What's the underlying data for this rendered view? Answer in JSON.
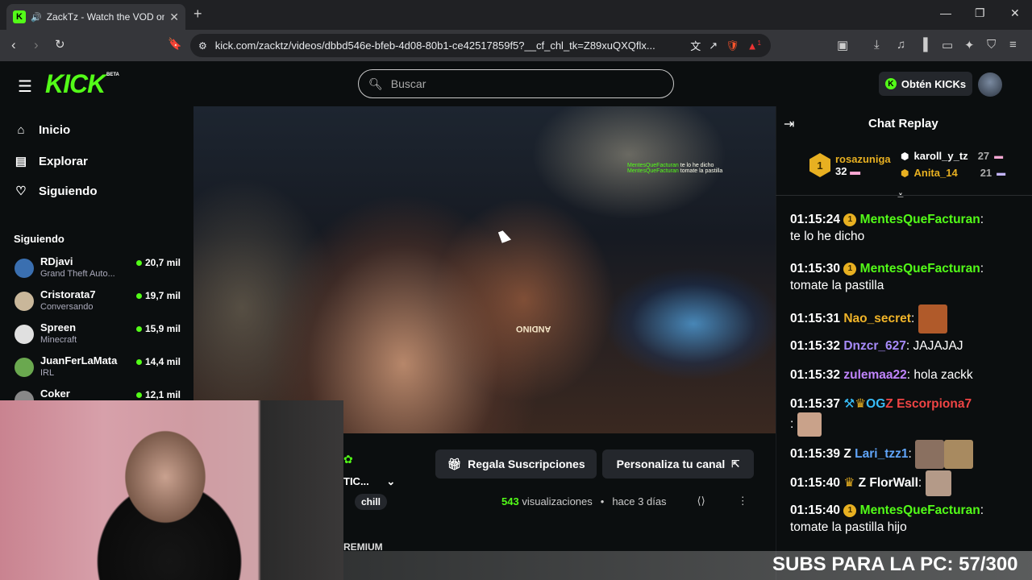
{
  "browser": {
    "tab_title": "ZackTz - Watch the VOD on Kick",
    "url": "kick.com/zacktz/videos/dbbd546e-bfeb-4d08-80b1-ce42517859f5?__cf_chl_tk=Z89xuQXQflx...",
    "ext_badge": "1"
  },
  "header": {
    "logo": "KICK",
    "beta": "BETA",
    "search_placeholder": "Buscar",
    "kicks_label": "Obtén KICKs"
  },
  "sidebar": {
    "nav": [
      {
        "label": "Inicio",
        "icon": "home-icon"
      },
      {
        "label": "Explorar",
        "icon": "compass-icon"
      },
      {
        "label": "Siguiendo",
        "icon": "heart-icon"
      }
    ],
    "section_title": "Siguiendo",
    "following": [
      {
        "name": "RDjavi",
        "category": "Grand Theft Auto...",
        "viewers": "20,7 mil",
        "color": "#3a6fb0"
      },
      {
        "name": "Cristorata7",
        "category": "Conversando",
        "viewers": "19,7 mil",
        "color": "#c9b79a"
      },
      {
        "name": "Spreen",
        "category": "Minecraft",
        "viewers": "15,9 mil",
        "color": "#e0e0e0"
      },
      {
        "name": "JuanFerLaMata",
        "category": "IRL",
        "viewers": "14,4 mil",
        "color": "#6aa84f"
      },
      {
        "name": "Coker",
        "category": "",
        "viewers": "12,1 mil",
        "color": "#888888"
      }
    ]
  },
  "video": {
    "overlay_name": "MentesQueFacturan",
    "overlay_line1": "te lo he dicho",
    "overlay_line2": "tomate la pastilla",
    "sign_text": "ANDINO"
  },
  "below": {
    "gift_label": "Regala Suscripciones",
    "customize_label": "Personaliza tu canal",
    "views_count": "543",
    "views_label": "visualizaciones",
    "ago": "hace 3 días",
    "tag": "chill",
    "channel_partial": "TIC...",
    "premium": "REMIUM"
  },
  "chat": {
    "title": "Chat Replay",
    "top_gifters": [
      {
        "name": "rosazuniga",
        "count": "32",
        "color": "#e8b021"
      },
      {
        "name": "karoll_y_tz",
        "count": "27",
        "color": "#ffffff"
      },
      {
        "name": "Anita_14",
        "count": "21",
        "color": "#e8b021"
      }
    ],
    "messages": [
      {
        "time": "01:15:24",
        "user": "MentesQueFacturan",
        "color": "#53fc18",
        "text": "te lo he dicho"
      },
      {
        "time": "01:15:30",
        "user": "MentesQueFacturan",
        "color": "#53fc18",
        "text": "tomate la pastilla"
      },
      {
        "time": "01:15:31",
        "user": "Nao_secret",
        "color": "#f0b429",
        "text": ""
      },
      {
        "time": "01:15:32",
        "user": "Dnzcr_627",
        "color": "#a78bfa",
        "text": "JAJAJAJ"
      },
      {
        "time": "01:15:32",
        "user": "zulemaa22",
        "color": "#c084fc",
        "text": "hola zackk"
      },
      {
        "time": "01:15:37",
        "user": "Escorpiona7",
        "color": "#ef4444",
        "text": ""
      },
      {
        "time": "01:15:39",
        "user": "Lari_tzz1",
        "color": "#60a5fa",
        "text": ""
      },
      {
        "time": "01:15:40",
        "user": "FlorWall",
        "color": "#ffffff",
        "text": ""
      },
      {
        "time": "01:15:40",
        "user": "MentesQueFacturan",
        "color": "#53fc18",
        "text": "tomate la pastilla hijo"
      }
    ]
  },
  "overlay": {
    "sub_goal": "SUBS PARA LA PC: 57/300"
  }
}
